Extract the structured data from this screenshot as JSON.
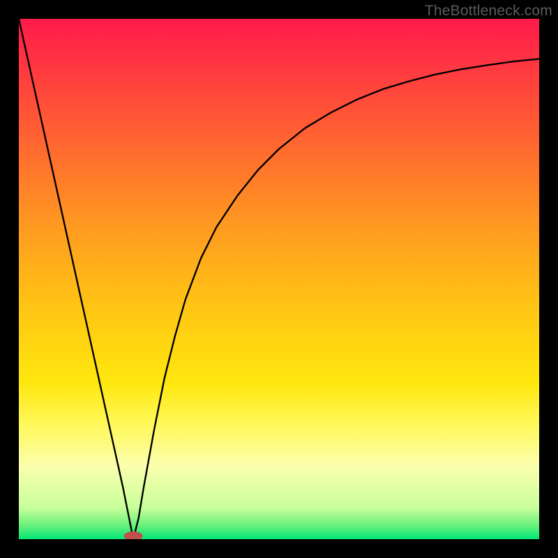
{
  "watermark": "TheBottleneck.com",
  "chart_data": {
    "type": "line",
    "title": "",
    "xlabel": "",
    "ylabel": "",
    "xlim": [
      0,
      100
    ],
    "ylim": [
      0,
      100
    ],
    "grid": false,
    "background_gradient": {
      "stops": [
        {
          "pos": 0.0,
          "color": "#ff1a4b"
        },
        {
          "pos": 0.1,
          "color": "#ff3a40"
        },
        {
          "pos": 0.25,
          "color": "#ff6a2f"
        },
        {
          "pos": 0.4,
          "color": "#ff9a20"
        },
        {
          "pos": 0.55,
          "color": "#ffc414"
        },
        {
          "pos": 0.7,
          "color": "#ffe70e"
        },
        {
          "pos": 0.78,
          "color": "#fff85a"
        },
        {
          "pos": 0.86,
          "color": "#fbffae"
        },
        {
          "pos": 0.94,
          "color": "#c8ff9a"
        },
        {
          "pos": 0.975,
          "color": "#63f07a"
        },
        {
          "pos": 1.0,
          "color": "#00e676"
        }
      ]
    },
    "series": [
      {
        "name": "curve",
        "stroke": "#000000",
        "x": [
          0,
          2,
          4,
          6,
          8,
          10,
          12,
          14,
          16,
          18,
          20,
          21,
          22,
          23,
          24,
          26,
          28,
          30,
          32,
          35,
          38,
          42,
          46,
          50,
          55,
          60,
          65,
          70,
          75,
          80,
          85,
          90,
          95,
          100
        ],
        "values": [
          100,
          91,
          82,
          73,
          64,
          55,
          46,
          37,
          28,
          19,
          10,
          5,
          0,
          4,
          10,
          21,
          31,
          39,
          46,
          54,
          60,
          66,
          71,
          75,
          79,
          82,
          84.5,
          86.5,
          88,
          89.3,
          90.3,
          91.1,
          91.8,
          92.3
        ]
      }
    ],
    "marker": {
      "name": "min-marker",
      "cx": 22,
      "cy": 0.6,
      "rx": 1.8,
      "ry": 0.9,
      "fill": "#c0504d"
    }
  }
}
